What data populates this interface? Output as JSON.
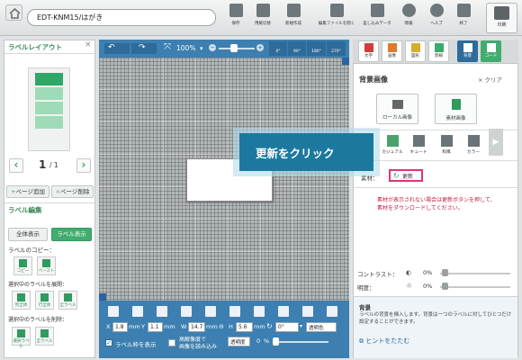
{
  "toolbar": {
    "title": "EDT-KNM15/はがき",
    "buttons": [
      {
        "label": "保存",
        "icon": "save-icon"
      },
      {
        "label": "用紙切替",
        "icon": "paper-switch-icon"
      },
      {
        "label": "新規作成",
        "icon": "new-file-icon"
      },
      {
        "label": "編集ファイルを開く",
        "icon": "open-file-icon"
      },
      {
        "label": "差し込みデータ",
        "icon": "merge-data-icon"
      },
      {
        "label": "情報",
        "icon": "info-icon"
      },
      {
        "label": "ヘルプ",
        "icon": "help-icon"
      },
      {
        "label": "終了",
        "icon": "exit-icon"
      }
    ],
    "print_label": "印刷"
  },
  "left": {
    "layout_title": "ラベルレイアウト",
    "page_current": "1",
    "page_total": "/ 1",
    "add_page": "ページ追加",
    "delete_page": "ページ削除",
    "edit_title": "ラベル編集",
    "show_all": "全体表示",
    "show_label": "ラベル表示",
    "copy_title": "ラベルのコピー：",
    "copy_btns": [
      "コピー",
      "ペースト"
    ],
    "expand_title": "選択中のラベルを展開：",
    "expand_btns": [
      "列全体",
      "行全体",
      "全ラベル"
    ],
    "delete_title": "選択中のラベルを削除：",
    "delete_btns": [
      "選択ラベル",
      "全ラベル"
    ]
  },
  "canvas": {
    "zoom": "100%",
    "rotate": [
      "0°",
      "90°",
      "180°",
      "270°"
    ],
    "x_label": "X",
    "x_value": "1.8",
    "y_label": "Y",
    "y_value": "1.1",
    "unit": "mm",
    "w_label": "W",
    "w_value": "14.7",
    "h_label": "H",
    "h_value": "5.6",
    "angle": "0°",
    "transparent_color": "透明色",
    "frame_label": "ラベル枠を表示",
    "hires_line1": "高解像度で",
    "hires_line2": "画像を読み込み",
    "opacity_label": "透明度",
    "opacity_value": "0",
    "opacity_unit": "%"
  },
  "right": {
    "tabs": [
      "文字",
      "画像",
      "図形",
      "罫線",
      "背景",
      "コード"
    ],
    "section_title": "背景画像",
    "clear": "クリア",
    "local_image": "ローカル画像",
    "material_image": "素材画像",
    "categories": [
      "カジュアル",
      "キュート",
      "和風",
      "カラー"
    ],
    "material_label": "素材：",
    "update": "更新",
    "warning": "素材が表示されない場合は更新ボタンを押して、素材をダウンロードしてください。",
    "contrast_label": "コントラスト：",
    "contrast_value": "0%",
    "brightness_label": "明度：",
    "brightness_value": "0%",
    "hint_title": "背景",
    "hint_text": "ラベルの背景を挿入します。背景は一つのラベルに対してひとつだけ設定することができます。",
    "hide_hint": "ヒントをたたむ"
  },
  "callout": "更新をクリック",
  "colors": {
    "accent_green": "#41ac6e",
    "canvas_blue": "#3c7fb0",
    "callout_blue": "#1b79a0",
    "warning_red": "#c41a3b"
  }
}
